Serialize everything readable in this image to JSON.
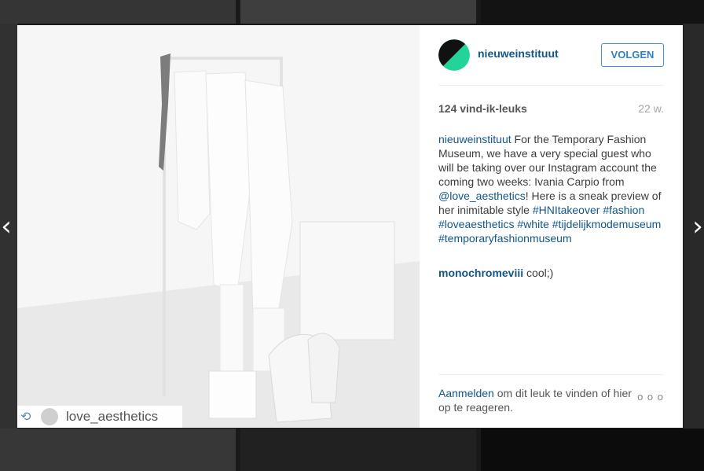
{
  "navigation": {
    "prev_icon": "‹",
    "next_icon": "›"
  },
  "post": {
    "repost_icon": "⟲",
    "repost_username": "love_aesthetics",
    "author": "nieuweinstituut",
    "follow_label": "VOLGEN",
    "likes": "124 vind-ik-leuks",
    "age": "22 w.",
    "caption": {
      "user": "nieuweinstituut",
      "text_1": " For the Temporary Fashion Museum, we have a very special guest who will be taking over our Instagram account the coming two weeks: Ivania Carpio from ",
      "mention": "@love_aesthetics",
      "text_2": "! Here is a sneak preview of her inimitable style ",
      "hashtags": [
        "#HNItakeover",
        "#fashion",
        "#loveaesthetics",
        "#white",
        "#tijdelijkmodemuseum",
        "#temporaryfashionmuseum"
      ]
    },
    "comment": {
      "user": "monochromeviii",
      "text": " cool;)"
    },
    "footer": {
      "login_link": "Aanmelden",
      "login_text": " om dit leuk te vinden of hier op te reageren.",
      "more_icon": "o o o"
    }
  },
  "colors": {
    "link": "#125688",
    "follow_border": "#4090db",
    "logo_green": "#22d39a",
    "logo_black": "#111111"
  }
}
